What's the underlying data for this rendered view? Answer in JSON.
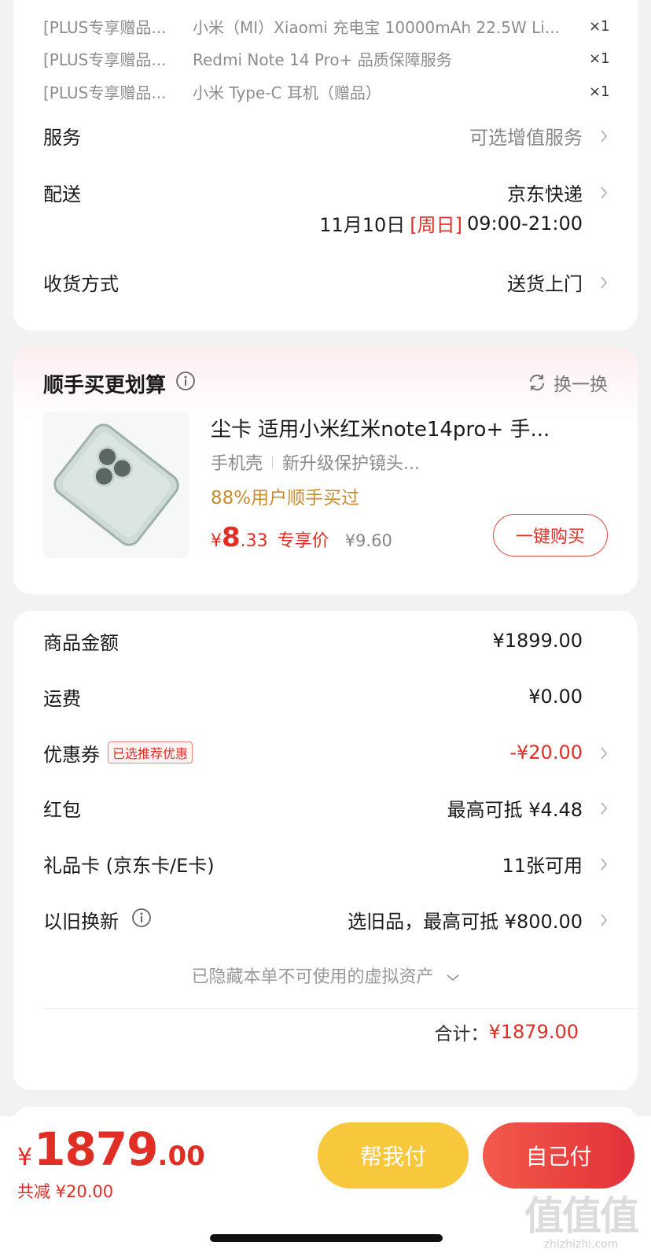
{
  "order_items": {
    "gifts": [
      {
        "tag": "[PLUS专享赠品...",
        "name": "小米（MI）Xiaomi 充电宝 10000mAh 22.5W Li...",
        "qty": "×1"
      },
      {
        "tag": "[PLUS专享赠品...",
        "name": "Redmi Note 14 Pro+ 品质保障服务",
        "qty": "×1"
      },
      {
        "tag": "[PLUS专享赠品...",
        "name": "小米 Type-C 耳机（赠品）",
        "qty": "×1"
      }
    ],
    "service": {
      "label": "服务",
      "value": "可选增值服务"
    },
    "delivery": {
      "label": "配送",
      "value": "京东快递",
      "date": "11月10日",
      "weekday": "[周日]",
      "time": "09:00-21:00"
    },
    "receive": {
      "label": "收货方式",
      "value": "送货上门"
    }
  },
  "recommend": {
    "title": "顺手买更划算",
    "swap_label": "换一换",
    "product": {
      "title": "尘卡 适用小米红米note14pro+ 手...",
      "tags": [
        "手机壳",
        "新升级保护镜头..."
      ],
      "buyers": "88%用户顺手买过",
      "price_symbol": "¥",
      "price_int": "8",
      "price_dec": ".33",
      "price_label": "专享价",
      "original_price": "¥9.60",
      "buy_label": "一键购买"
    }
  },
  "summary": {
    "rows": [
      {
        "label": "商品金额",
        "value": "¥1899.00"
      },
      {
        "label": "运费",
        "value": "¥0.00"
      },
      {
        "label": "优惠券",
        "badge": "已选推荐优惠",
        "value": "-¥20.00"
      },
      {
        "label": "红包",
        "value": "最高可抵 ¥4.48"
      },
      {
        "label": "礼品卡 (京东卡/E卡)",
        "value": "11张可用"
      },
      {
        "label": "以旧换新",
        "value": "选旧品，最高可抵 ¥800.00"
      }
    ],
    "hidden_assets": "已隐藏本单不可使用的虚拟资产",
    "total_label": "合计：",
    "total_value": "¥1879.00"
  },
  "bottom_bar": {
    "price_symbol": "¥",
    "price_int": "1879",
    "price_dec": ".00",
    "saved": "共减 ¥20.00",
    "help_pay": "帮我付",
    "self_pay": "自己付"
  },
  "watermark": {
    "logo": "值值值",
    "site": "zhizhizhi.com"
  },
  "colors": {
    "accent_red": "#e02e24",
    "help_yellow": "#f7c83c",
    "buyers_orange": "#c88b2e"
  }
}
